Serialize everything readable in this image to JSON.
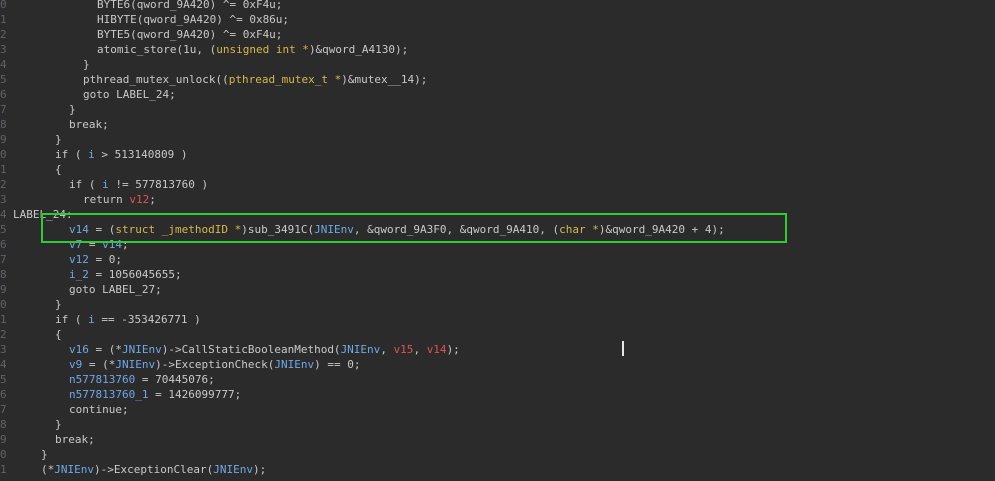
{
  "colors": {
    "background": "#2b2b2b",
    "plain": "#c9c9c9",
    "variable": "#6fa8e8",
    "type": "#d7b84a",
    "highlight_var": "#e05252",
    "line_number": "#5f6368",
    "selection_box": "#2ecc2e"
  },
  "lines": [
    {
      "n": "0",
      "indent": 6,
      "tokens": [
        {
          "t": "p",
          "s": "BYTE6(qword_9A420) ^= 0xF4u;"
        }
      ]
    },
    {
      "n": "1",
      "indent": 6,
      "tokens": [
        {
          "t": "p",
          "s": "HIBYTE(qword_9A420) ^= 0x86u;"
        }
      ]
    },
    {
      "n": "2",
      "indent": 6,
      "tokens": [
        {
          "t": "p",
          "s": "BYTE5(qword_9A420) ^= 0xF4u;"
        }
      ]
    },
    {
      "n": "3",
      "indent": 6,
      "tokens": [
        {
          "t": "p",
          "s": "atomic_store(1u, ("
        },
        {
          "t": "t",
          "s": "unsigned int *"
        },
        {
          "t": "p",
          "s": ")&qword_A4130);"
        }
      ]
    },
    {
      "n": "4",
      "indent": 5,
      "tokens": [
        {
          "t": "p",
          "s": "}"
        }
      ]
    },
    {
      "n": "5",
      "indent": 5,
      "tokens": [
        {
          "t": "p",
          "s": "pthread_mutex_unlock(("
        },
        {
          "t": "t",
          "s": "pthread_mutex_t *"
        },
        {
          "t": "p",
          "s": ")&mutex__14);"
        }
      ]
    },
    {
      "n": "6",
      "indent": 5,
      "tokens": [
        {
          "t": "p",
          "s": "goto LABEL_24;"
        }
      ]
    },
    {
      "n": "7",
      "indent": 4,
      "tokens": [
        {
          "t": "p",
          "s": "}"
        }
      ]
    },
    {
      "n": "8",
      "indent": 4,
      "tokens": [
        {
          "t": "p",
          "s": "break;"
        }
      ]
    },
    {
      "n": "9",
      "indent": 3,
      "tokens": [
        {
          "t": "p",
          "s": "}"
        }
      ]
    },
    {
      "n": "0",
      "indent": 3,
      "tokens": [
        {
          "t": "p",
          "s": "if ( "
        },
        {
          "t": "v",
          "s": "i"
        },
        {
          "t": "p",
          "s": " > 513140809 )"
        }
      ]
    },
    {
      "n": "1",
      "indent": 3,
      "tokens": [
        {
          "t": "p",
          "s": "{"
        }
      ]
    },
    {
      "n": "2",
      "indent": 4,
      "tokens": [
        {
          "t": "p",
          "s": "if ( "
        },
        {
          "t": "v",
          "s": "i"
        },
        {
          "t": "p",
          "s": " != 577813760 )"
        }
      ]
    },
    {
      "n": "3",
      "indent": 5,
      "tokens": [
        {
          "t": "p",
          "s": "return "
        },
        {
          "t": "r",
          "s": "v12"
        },
        {
          "t": "p",
          "s": ";"
        }
      ]
    },
    {
      "n": "4",
      "indent": 0,
      "label": true,
      "tokens": [
        {
          "t": "p",
          "s": "LABEL_24:"
        }
      ]
    },
    {
      "n": "5",
      "indent": 4,
      "tokens": [
        {
          "t": "v",
          "s": "v14"
        },
        {
          "t": "p",
          "s": " = ("
        },
        {
          "t": "t",
          "s": "struct _jmethodID *"
        },
        {
          "t": "p",
          "s": ")sub_3491C("
        },
        {
          "t": "v",
          "s": "JNIEnv"
        },
        {
          "t": "p",
          "s": ", &qword_9A3F0, &qword_9A410, ("
        },
        {
          "t": "t",
          "s": "char *"
        },
        {
          "t": "p",
          "s": ")&qword_9A420 + 4);"
        }
      ]
    },
    {
      "n": "6",
      "indent": 4,
      "tokens": [
        {
          "t": "v",
          "s": "v7"
        },
        {
          "t": "p",
          "s": " = "
        },
        {
          "t": "v",
          "s": "v14"
        },
        {
          "t": "p",
          "s": ";"
        }
      ]
    },
    {
      "n": "7",
      "indent": 4,
      "tokens": [
        {
          "t": "v",
          "s": "v12"
        },
        {
          "t": "p",
          "s": " = 0;"
        }
      ]
    },
    {
      "n": "8",
      "indent": 4,
      "tokens": [
        {
          "t": "v",
          "s": "i_2"
        },
        {
          "t": "p",
          "s": " = 1056045655;"
        }
      ]
    },
    {
      "n": "9",
      "indent": 4,
      "tokens": [
        {
          "t": "p",
          "s": "goto LABEL_27;"
        }
      ]
    },
    {
      "n": "0",
      "indent": 3,
      "tokens": [
        {
          "t": "p",
          "s": "}"
        }
      ]
    },
    {
      "n": "1",
      "indent": 3,
      "tokens": [
        {
          "t": "p",
          "s": "if ( "
        },
        {
          "t": "v",
          "s": "i"
        },
        {
          "t": "p",
          "s": " == -353426771 )"
        }
      ]
    },
    {
      "n": "2",
      "indent": 3,
      "tokens": [
        {
          "t": "p",
          "s": "{"
        }
      ]
    },
    {
      "n": "3",
      "indent": 4,
      "tokens": [
        {
          "t": "v",
          "s": "v16"
        },
        {
          "t": "p",
          "s": " = (*"
        },
        {
          "t": "v",
          "s": "JNIEnv"
        },
        {
          "t": "p",
          "s": ")->CallStaticBooleanMethod("
        },
        {
          "t": "v",
          "s": "JNIEnv"
        },
        {
          "t": "p",
          "s": ", "
        },
        {
          "t": "r",
          "s": "v15"
        },
        {
          "t": "p",
          "s": ", "
        },
        {
          "t": "r",
          "s": "v14"
        },
        {
          "t": "p",
          "s": ");"
        }
      ]
    },
    {
      "n": "4",
      "indent": 4,
      "tokens": [
        {
          "t": "v",
          "s": "v9"
        },
        {
          "t": "p",
          "s": " = (*"
        },
        {
          "t": "v",
          "s": "JNIEnv"
        },
        {
          "t": "p",
          "s": ")->ExceptionCheck("
        },
        {
          "t": "v",
          "s": "JNIEnv"
        },
        {
          "t": "p",
          "s": ") == 0;"
        }
      ]
    },
    {
      "n": "5",
      "indent": 4,
      "tokens": [
        {
          "t": "v",
          "s": "n577813760"
        },
        {
          "t": "p",
          "s": " = 70445076;"
        }
      ]
    },
    {
      "n": "6",
      "indent": 4,
      "tokens": [
        {
          "t": "v",
          "s": "n577813760_1"
        },
        {
          "t": "p",
          "s": " = 1426099777;"
        }
      ]
    },
    {
      "n": "7",
      "indent": 4,
      "tokens": [
        {
          "t": "p",
          "s": "continue;"
        }
      ]
    },
    {
      "n": "8",
      "indent": 3,
      "tokens": [
        {
          "t": "p",
          "s": "}"
        }
      ]
    },
    {
      "n": "9",
      "indent": 3,
      "tokens": [
        {
          "t": "p",
          "s": "break;"
        }
      ]
    },
    {
      "n": "0",
      "indent": 2,
      "tokens": [
        {
          "t": "p",
          "s": "}"
        }
      ]
    },
    {
      "n": "1",
      "indent": 2,
      "tokens": [
        {
          "t": "p",
          "s": "(*"
        },
        {
          "t": "v",
          "s": "JNIEnv"
        },
        {
          "t": "p",
          "s": ")->ExceptionClear("
        },
        {
          "t": "v",
          "s": "JNIEnv"
        },
        {
          "t": "p",
          "s": ");"
        }
      ]
    }
  ]
}
